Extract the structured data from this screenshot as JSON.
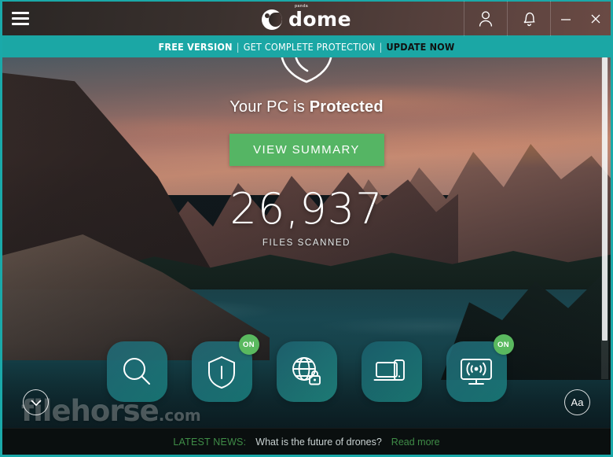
{
  "window": {
    "menu_icon": "hamburger-icon",
    "logo_sub": "panda",
    "logo_text": "dome",
    "account_icon": "user-icon",
    "notification_icon": "bell-icon",
    "minimize_label": "–",
    "close_label": "×"
  },
  "promo": {
    "free_version": "FREE VERSION",
    "separator": "|",
    "middle": "GET COMPLETE PROTECTION",
    "update_now": "UPDATE NOW"
  },
  "hero": {
    "shield_icon": "shield-check-icon",
    "status_prefix": "Your PC is ",
    "status_strong": "Protected",
    "summary_button": "VIEW SUMMARY",
    "files_count": "26,937",
    "files_label": "FILES SCANNED"
  },
  "tiles": [
    {
      "name": "scan",
      "icon": "magnifier-icon",
      "badge": ""
    },
    {
      "name": "protection",
      "icon": "shield-icon",
      "badge": "ON"
    },
    {
      "name": "vpn",
      "icon": "globe-lock-icon",
      "badge": ""
    },
    {
      "name": "devices",
      "icon": "laptop-phone-icon",
      "badge": ""
    },
    {
      "name": "wifi-monitor",
      "icon": "monitor-wifi-icon",
      "badge": "ON"
    }
  ],
  "corner_buttons": {
    "expand_icon": "chevron-down-icon",
    "text_size_label": "Aa"
  },
  "watermark": {
    "name": "filehorse",
    "suffix": ".com"
  },
  "news": {
    "label": "LATEST NEWS:",
    "headline": "What is the future of drones?",
    "read_more": "Read more"
  },
  "colors": {
    "accent_teal": "#1ba7a5",
    "accent_green": "#55b564",
    "badge_green": "#5ab95f",
    "news_green": "#3f8c47",
    "tile_teal": "#1a8482"
  }
}
